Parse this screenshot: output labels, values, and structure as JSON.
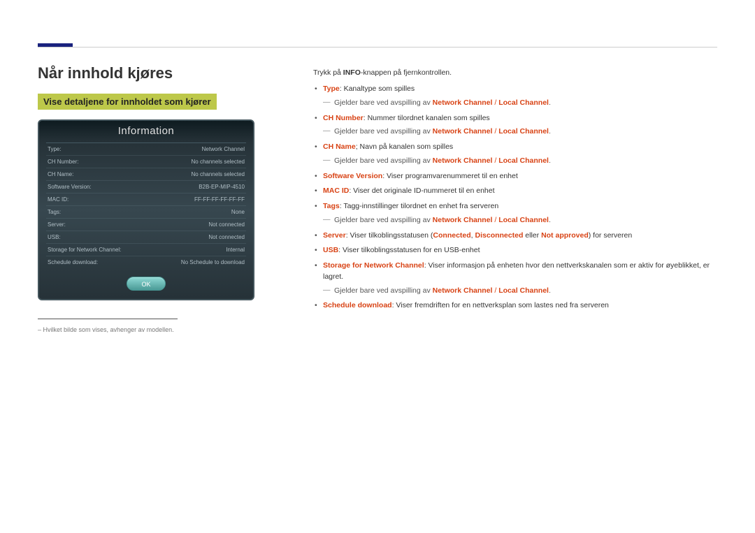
{
  "heading": "Når innhold kjøres",
  "subheading": "Vise detaljene for innholdet som kjører",
  "infoPanel": {
    "title": "Information",
    "rows": [
      {
        "label": "Type:",
        "value": "Network Channel"
      },
      {
        "label": "CH Number:",
        "value": "No channels selected"
      },
      {
        "label": "CH Name:",
        "value": "No channels selected"
      },
      {
        "label": "Software Version:",
        "value": "B2B-EP-MIP-4510"
      },
      {
        "label": "MAC ID:",
        "value": "FF-FF-FF-FF-FF-FF"
      },
      {
        "label": "Tags:",
        "value": "None"
      },
      {
        "label": "Server:",
        "value": "Not connected"
      },
      {
        "label": "USB:",
        "value": "Not connected"
      },
      {
        "label": "Storage for Network Channel:",
        "value": "Internal"
      },
      {
        "label": "Schedule download:",
        "value": "No Schedule to download"
      }
    ],
    "ok": "OK"
  },
  "footnote": "Hvilket bilde som vises, avhenger av modellen.",
  "intro": {
    "pre": "Trykk på ",
    "bold": "INFO",
    "post": "-knappen på fjernkontrollen."
  },
  "subtext": {
    "pre": "Gjelder bare ved avspilling av ",
    "nc": "Network Channel",
    "sep": " / ",
    "lc": "Local Channel",
    "end": "."
  },
  "items": {
    "type": {
      "label": "Type",
      "text": ": Kanaltype som spilles"
    },
    "chnum": {
      "label": "CH Number",
      "text": ": Nummer tilordnet kanalen som spilles"
    },
    "chname": {
      "label": "CH Name",
      "text": "; Navn på kanalen som spilles"
    },
    "swver": {
      "label": "Software Version",
      "text": ": Viser programvarenummeret til en enhet"
    },
    "macid": {
      "label": "MAC ID",
      "text": ": Viser det originale ID-nummeret til en enhet"
    },
    "tags": {
      "label": "Tags",
      "text": ": Tagg-innstillinger tilordnet en enhet fra serveren"
    },
    "server": {
      "label": "Server",
      "pre": ": Viser tilkoblingsstatusen (",
      "connected": "Connected",
      "c1": ", ",
      "disconnected": "Disconnected",
      "c2": " eller ",
      "notapproved": "Not approved",
      "post": ") for serveren"
    },
    "usb": {
      "label": "USB",
      "text": ": Viser tilkoblingsstatusen for en USB-enhet"
    },
    "storage": {
      "label": "Storage for Network Channel",
      "text": ": Viser informasjon på enheten hvor den nettverkskanalen som er aktiv for øyeblikket, er lagret."
    },
    "schedule": {
      "label": "Schedule download",
      "text": ": Viser fremdriften for en nettverksplan som lastes ned fra serveren"
    }
  }
}
